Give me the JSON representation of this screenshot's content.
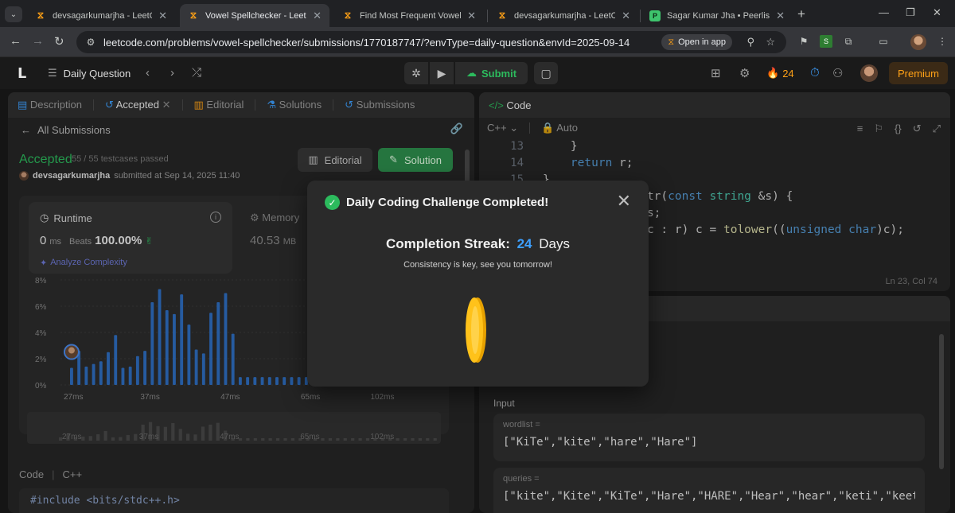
{
  "browser": {
    "tabs": [
      {
        "title": "devsagarkumarjha - LeetCode Profile",
        "icon": "leetcode"
      },
      {
        "title": "Vowel Spellchecker - LeetCode",
        "icon": "leetcode",
        "active": true
      },
      {
        "title": "Find Most Frequent Vowel and Consonant",
        "icon": "leetcode"
      },
      {
        "title": "devsagarkumarjha - LeetCode Profile",
        "icon": "leetcode"
      },
      {
        "title": "Sagar Kumar Jha • Peerlist",
        "icon": "peerlist"
      }
    ],
    "url": "leetcode.com/problems/vowel-spellchecker/submissions/1770187747/?envType=daily-question&envId=2025-09-14",
    "open_in_app": "Open in app"
  },
  "lc_nav": {
    "daily_question": "Daily Question",
    "submit": "Submit",
    "streak": "24",
    "premium": "Premium"
  },
  "left_panel": {
    "tabs": [
      "Description",
      "Accepted",
      "Editorial",
      "Solutions",
      "Submissions"
    ],
    "all_submissions": "All Submissions",
    "status": "Accepted",
    "testcases": "55 / 55 testcases passed",
    "user": "devsagarkumarjha",
    "submitted_at": "submitted at Sep 14, 2025 11:40",
    "editorial_btn": "Editorial",
    "solution_btn": "Solution",
    "runtime": {
      "title": "Runtime",
      "value": "0",
      "unit": "ms",
      "beats_label": "Beats",
      "beats_pct": "100.00%",
      "analyze": "Analyze Complexity"
    },
    "memory": {
      "title": "Memory",
      "value": "40.53",
      "unit": "MB"
    },
    "code_label": "Code",
    "code_lang": "C++",
    "code_line": "#include <bits/stdc++.h>"
  },
  "chart_data": {
    "type": "bar",
    "ylabel": "",
    "xlabel": "",
    "y_ticks": [
      "8%",
      "6%",
      "4%",
      "2%",
      "0%"
    ],
    "ylim": [
      0,
      8
    ],
    "x_ticks": [
      "27ms",
      "37ms",
      "47ms",
      "65ms",
      "102ms"
    ],
    "values": [
      1.3,
      2.6,
      1.4,
      1.6,
      1.8,
      2.5,
      3.8,
      1.3,
      1.4,
      2.2,
      2.6,
      6.3,
      7.3,
      5.7,
      5.4,
      6.9,
      4.6,
      2.7,
      2.4,
      5.5,
      6.3,
      7.0,
      3.9,
      0.6,
      0.6,
      0.6,
      0.6,
      0.6,
      0.6,
      0.6,
      0.6,
      0.6,
      0.6,
      0.6,
      0.6,
      0.6,
      0.6,
      0.6,
      0.6,
      0.6,
      0.6,
      0.6,
      0.6,
      0.6,
      0.6,
      0.6,
      0.6,
      0.6,
      0.6,
      0.6,
      0.6
    ],
    "colors": {
      "bar": "#2f6fc4",
      "marker_highlight": "#4a8df0"
    },
    "highlight_index": 0
  },
  "editor": {
    "title": "Code",
    "lang": "C++",
    "mode": "Auto",
    "line_numbers": [
      "13",
      "14",
      "15",
      "",
      "",
      "",
      "",
      "",
      ""
    ],
    "lines": [
      {
        "parts": [
          {
            "t": "    }",
            "c": ""
          }
        ]
      },
      {
        "parts": [
          {
            "t": "    ",
            "c": ""
          },
          {
            "t": "return",
            "c": "kw"
          },
          {
            "t": " r;",
            "c": ""
          }
        ]
      },
      {
        "parts": [
          {
            "t": "}",
            "c": ""
          }
        ]
      },
      {
        "parts": [
          {
            "t": "              Str(",
            "c": ""
          },
          {
            "t": "const",
            "c": "kw"
          },
          {
            "t": " ",
            "c": ""
          },
          {
            "t": "string",
            "c": "ty"
          },
          {
            "t": " &s) {",
            "c": ""
          }
        ]
      },
      {
        "parts": [
          {
            "t": "               s;",
            "c": ""
          }
        ]
      },
      {
        "parts": [
          {
            "t": "              &c : r) c = ",
            "c": ""
          },
          {
            "t": "tolower",
            "c": "fn"
          },
          {
            "t": "((",
            "c": ""
          },
          {
            "t": "unsigned",
            "c": "kw"
          },
          {
            "t": " ",
            "c": ""
          },
          {
            "t": "char",
            "c": "kw"
          },
          {
            "t": ")c);",
            "c": ""
          }
        ]
      }
    ],
    "cursor": "Ln 23, Col 74"
  },
  "testcase": {
    "input_label": "Input",
    "wordlist_name": "wordlist =",
    "wordlist_value": "[\"KiTe\",\"kite\",\"hare\",\"Hare\"]",
    "queries_name": "queries =",
    "queries_value": "[\"kite\",\"Kite\",\"KiTe\",\"Hare\",\"HARE\",\"Hear\",\"hear\",\"keti\",\"keet\",\"keto"
  },
  "modal": {
    "title": "Daily Coding Challenge Completed!",
    "streak_label": "Completion Streak:",
    "streak_value": "24",
    "streak_unit": "Days",
    "subtitle": "Consistency is key, see you tomorrow!"
  }
}
